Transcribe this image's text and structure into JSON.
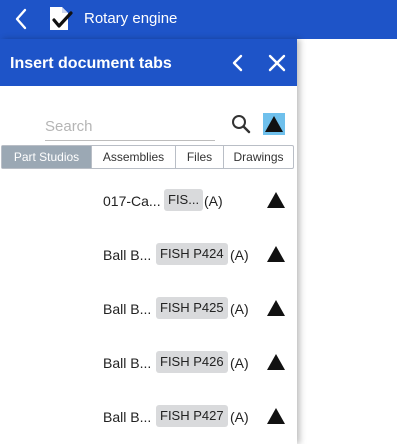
{
  "app": {
    "title": "Rotary engine",
    "back_icon": "chevron-left-icon",
    "doc_icon": "document-check-icon"
  },
  "panel": {
    "title": "Insert document tabs",
    "back_icon": "chevron-left-icon",
    "close_icon": "close-icon"
  },
  "search": {
    "placeholder": "Search",
    "value": "",
    "icon": "search-icon",
    "filter_icon": "filter-triangle-icon"
  },
  "tabs": [
    {
      "label": "Part Studios",
      "active": true
    },
    {
      "label": "Assemblies",
      "active": false
    },
    {
      "label": "Files",
      "active": false
    },
    {
      "label": "Drawings",
      "active": false
    }
  ],
  "items": [
    {
      "name": "017-Ca...",
      "badge": "FIS...",
      "rev": "(A)",
      "icon": "part-studio-triangle-icon"
    },
    {
      "name": "Ball B...",
      "badge": "FISH P424",
      "rev": "(A)",
      "icon": "part-studio-triangle-icon"
    },
    {
      "name": "Ball B...",
      "badge": "FISH P425",
      "rev": "(A)",
      "icon": "part-studio-triangle-icon"
    },
    {
      "name": "Ball B...",
      "badge": "FISH P426",
      "rev": "(A)",
      "icon": "part-studio-triangle-icon"
    },
    {
      "name": "Ball B...",
      "badge": "FISH P427",
      "rev": "(A)",
      "icon": "part-studio-triangle-icon"
    }
  ],
  "colors": {
    "header_blue": "#1e54c8",
    "tab_active_bg": "#9ba8b4",
    "badge_bg": "#d9dadc"
  }
}
